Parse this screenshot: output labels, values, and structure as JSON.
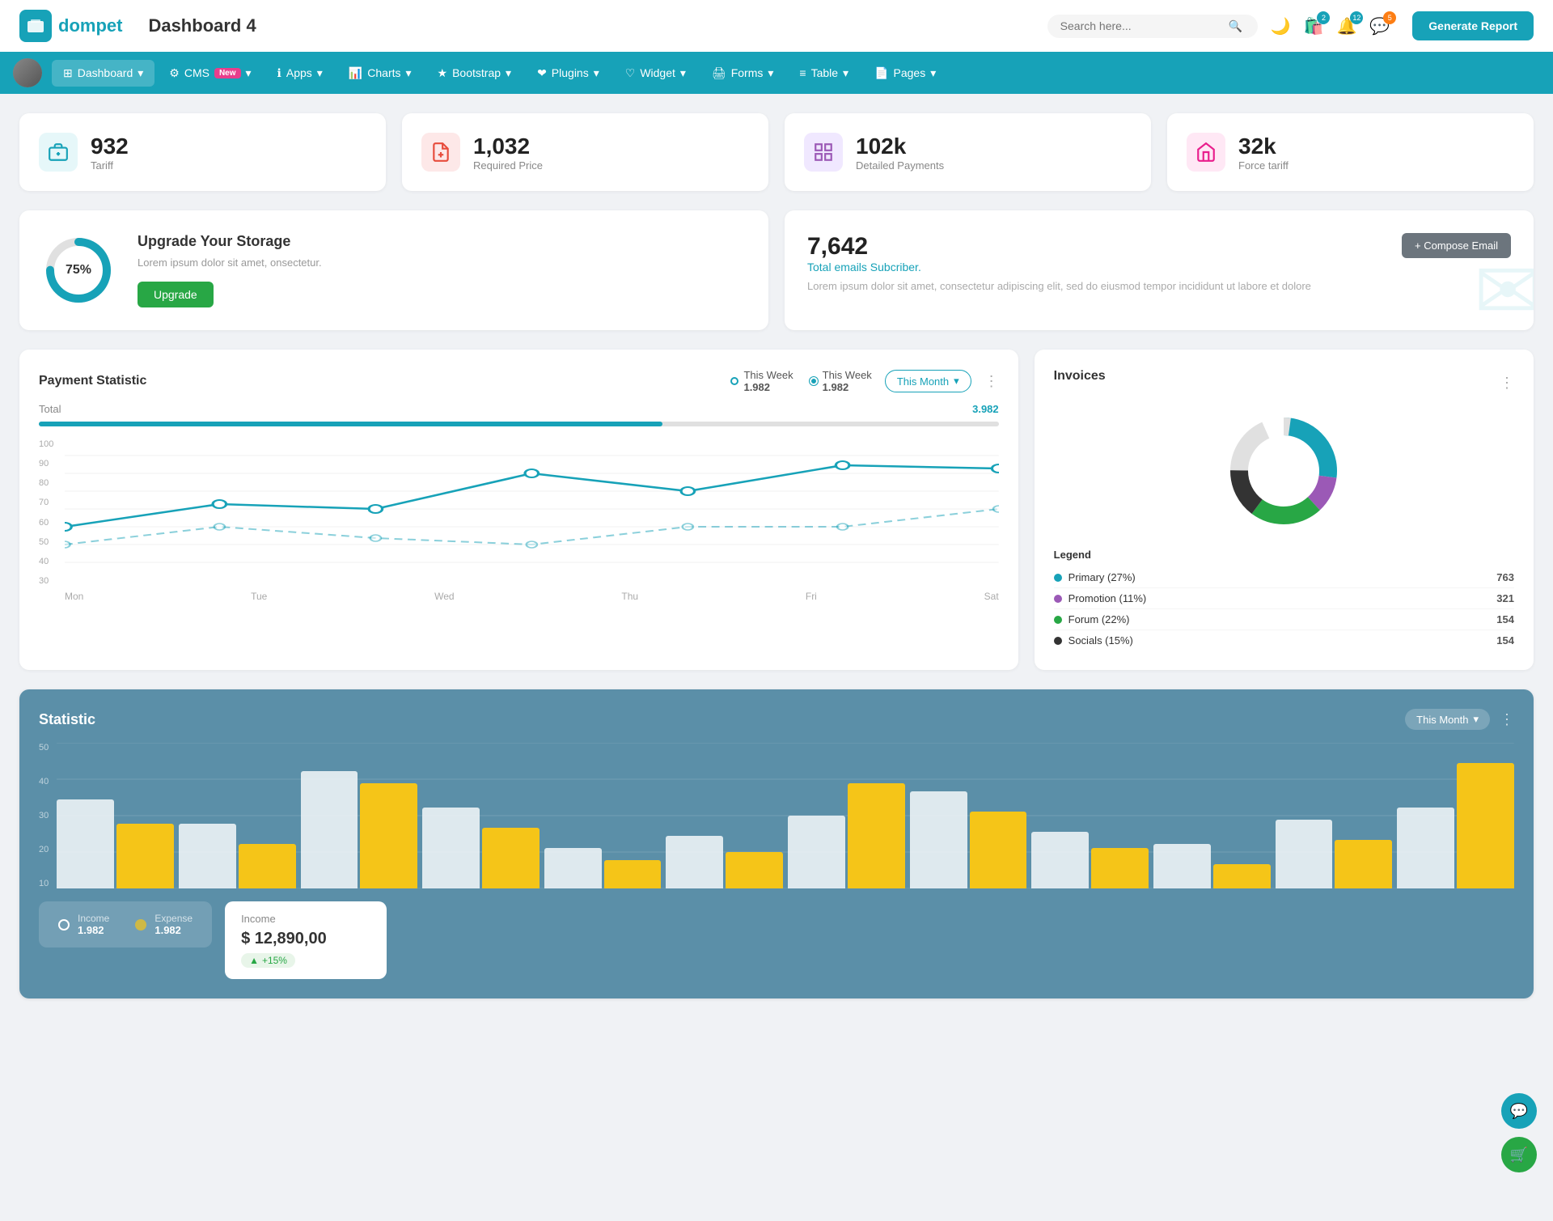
{
  "header": {
    "logo_text": "dompet",
    "page_title": "Dashboard 4",
    "search_placeholder": "Search here...",
    "generate_btn_label": "Generate Report",
    "icons": {
      "shop_badge": "2",
      "bell_badge": "12",
      "chat_badge": "5"
    }
  },
  "nav": {
    "items": [
      {
        "label": "Dashboard",
        "active": true,
        "has_arrow": true
      },
      {
        "label": "CMS",
        "badge": "New",
        "has_arrow": true
      },
      {
        "label": "Apps",
        "has_arrow": true
      },
      {
        "label": "Charts",
        "has_arrow": true
      },
      {
        "label": "Bootstrap",
        "has_arrow": true
      },
      {
        "label": "Plugins",
        "has_arrow": true
      },
      {
        "label": "Widget",
        "has_arrow": true
      },
      {
        "label": "Forms",
        "has_arrow": true
      },
      {
        "label": "Table",
        "has_arrow": true
      },
      {
        "label": "Pages",
        "has_arrow": true
      }
    ]
  },
  "stat_cards": [
    {
      "value": "932",
      "label": "Tariff",
      "icon_type": "teal",
      "icon": "briefcase"
    },
    {
      "value": "1,032",
      "label": "Required Price",
      "icon_type": "red",
      "icon": "file"
    },
    {
      "value": "102k",
      "label": "Detailed Payments",
      "icon_type": "purple",
      "icon": "chart"
    },
    {
      "value": "32k",
      "label": "Force tariff",
      "icon_type": "pink",
      "icon": "building"
    }
  ],
  "storage": {
    "percent": "75%",
    "title": "Upgrade Your Storage",
    "description": "Lorem ipsum dolor sit amet, onsectetur.",
    "btn_label": "Upgrade"
  },
  "email_card": {
    "number": "7,642",
    "subtitle": "Total emails Subcriber.",
    "description": "Lorem ipsum dolor sit amet, consectetur adipiscing elit, sed do eiusmod tempor incididunt ut labore et dolore",
    "compose_btn": "+ Compose Email"
  },
  "payment_statistic": {
    "title": "Payment Statistic",
    "filter_label": "This Month",
    "legend": [
      {
        "label": "This Week",
        "value": "1.982"
      },
      {
        "label": "This Week",
        "value": "1.982"
      }
    ],
    "total_label": "Total",
    "total_value": "3.982",
    "progress_percent": 65,
    "x_labels": [
      "Mon",
      "Tue",
      "Wed",
      "Thu",
      "Fri",
      "Sat"
    ],
    "y_labels": [
      "100",
      "90",
      "80",
      "70",
      "60",
      "50",
      "40",
      "30"
    ]
  },
  "invoices": {
    "title": "Invoices",
    "legend": [
      {
        "label": "Primary (27%)",
        "count": "763",
        "color": "#17a2b8"
      },
      {
        "label": "Promotion (11%)",
        "count": "321",
        "color": "#9b59b6"
      },
      {
        "label": "Forum (22%)",
        "count": "154",
        "color": "#28a745"
      },
      {
        "label": "Socials (15%)",
        "count": "154",
        "color": "#333"
      }
    ]
  },
  "statistic": {
    "title": "Statistic",
    "filter_label": "This Month",
    "y_labels": [
      "50",
      "40",
      "30",
      "20",
      "10"
    ],
    "income_legend": "Income",
    "income_value": "1.982",
    "expense_legend": "Expense",
    "expense_value": "1.982",
    "income_detail": {
      "label": "Income",
      "amount": "$ 12,890,00",
      "badge": "+15%"
    }
  }
}
